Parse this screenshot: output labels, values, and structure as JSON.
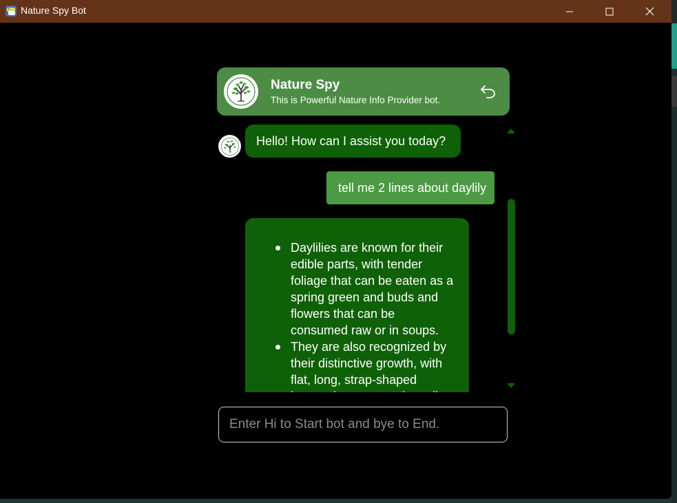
{
  "window": {
    "title": "Nature Spy Bot"
  },
  "header": {
    "title": "Nature Spy",
    "subtitle": "This is Powerful Nature Info Provider bot."
  },
  "chat": {
    "bot_greeting": "Hello! How can I assist you today?",
    "user_message": "tell me 2 lines about daylily",
    "bot_response_items": [
      "Daylilies are known for their edible parts, with tender foliage that can be eaten as a spring green and buds and flowers that can be consumed raw or in soups.",
      "They are also recognized by their distinctive growth, with flat, long, strap-shaped leaves that support the yellow"
    ]
  },
  "input": {
    "placeholder": "Enter Hi to Start bot and bye to End.",
    "value": ""
  },
  "icons": {
    "app": "python-icon",
    "logo": "tree-icon",
    "back": "undo-icon",
    "minimize": "minimize-icon",
    "maximize": "maximize-icon",
    "close": "close-icon"
  },
  "colors": {
    "titlebar": "#643318",
    "header_card": "#4c8c44",
    "bot_bubble": "#0e6107",
    "user_bubble": "#4c9a43",
    "background": "#000000"
  }
}
